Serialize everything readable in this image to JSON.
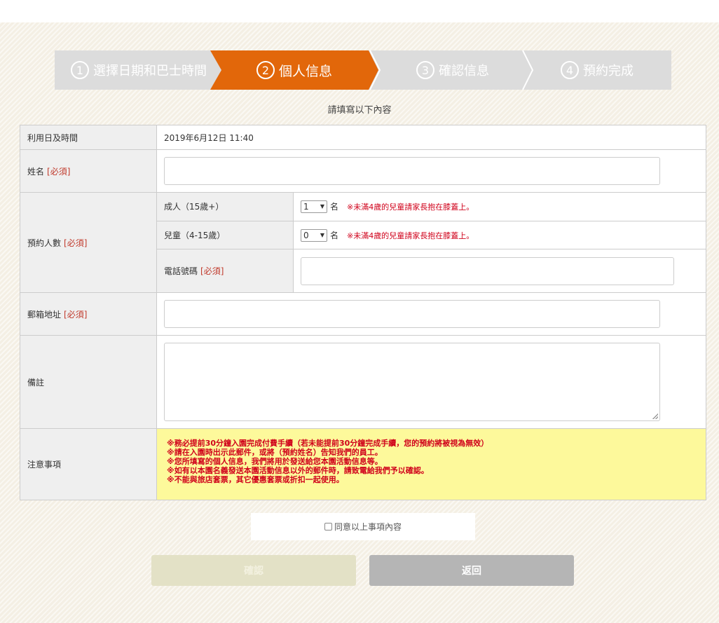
{
  "steps": [
    {
      "num": "1",
      "label": "選擇日期和巴士時間",
      "active": false
    },
    {
      "num": "2",
      "label": "個人信息",
      "active": true
    },
    {
      "num": "3",
      "label": "確認信息",
      "active": false
    },
    {
      "num": "4",
      "label": "預約完成",
      "active": false
    }
  ],
  "instruction": "請填寫以下內容",
  "form": {
    "datetime_label": "利用日及時間",
    "datetime_value": "2019年6月12日 11:40",
    "name_label": "姓名",
    "required_tag": "[必須]",
    "people_label": "預約人數",
    "adult_label": "成人（15歲+）",
    "adult_value": "1",
    "child_label": "兒童（4-15歲）",
    "child_value": "0",
    "unit": "名",
    "child_note": "※未滿4歲的兒童請家長抱在膝蓋上。",
    "phone_label": "電話號碼",
    "email_label": "郵箱地址",
    "remarks_label": "備註",
    "notice_label": "注意事項",
    "notices": [
      "※務必提前30分鐘入園完成付費手續（若未能提前30分鐘完成手續，您的預約將被視為無效）",
      "※請在入園時出示此郵件，或將（預約姓名）告知我們的員工。",
      "※您所填寫的個人信息，我們將用於發送給您本園活動信息等。",
      "※如有以本園名義發送本園活動信息以外的郵件時，請致電給我們予以確認。",
      "※不能與旅店套票，其它優惠套票或折扣一起使用。"
    ]
  },
  "agree_label": "同意以上事項內容",
  "buttons": {
    "confirm": "確認",
    "back": "返回"
  },
  "colors": {
    "active_step": "#e2670a",
    "inactive_step": "#dcdcdc",
    "required": "#c0392b",
    "notice_bg": "#fdf99b"
  }
}
